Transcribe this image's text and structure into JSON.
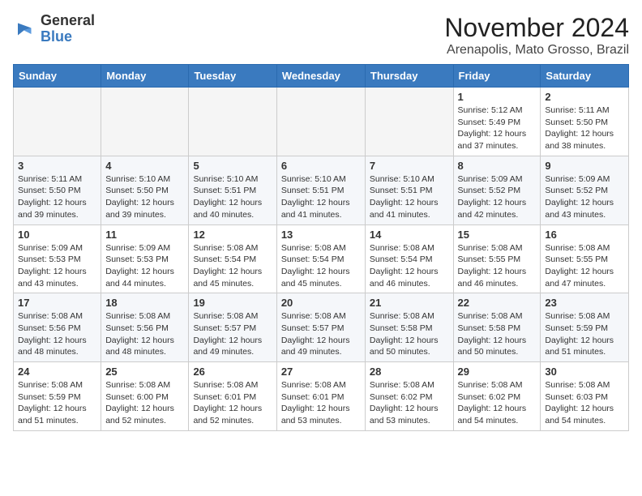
{
  "header": {
    "logo_line1": "General",
    "logo_line2": "Blue",
    "month": "November 2024",
    "location": "Arenapolis, Mato Grosso, Brazil"
  },
  "days_of_week": [
    "Sunday",
    "Monday",
    "Tuesday",
    "Wednesday",
    "Thursday",
    "Friday",
    "Saturday"
  ],
  "weeks": [
    [
      {
        "day": "",
        "empty": true
      },
      {
        "day": "",
        "empty": true
      },
      {
        "day": "",
        "empty": true
      },
      {
        "day": "",
        "empty": true
      },
      {
        "day": "",
        "empty": true
      },
      {
        "day": "1",
        "sunrise": "5:12 AM",
        "sunset": "5:49 PM",
        "daylight": "12 hours and 37 minutes."
      },
      {
        "day": "2",
        "sunrise": "5:11 AM",
        "sunset": "5:50 PM",
        "daylight": "12 hours and 38 minutes."
      }
    ],
    [
      {
        "day": "3",
        "sunrise": "5:11 AM",
        "sunset": "5:50 PM",
        "daylight": "12 hours and 39 minutes."
      },
      {
        "day": "4",
        "sunrise": "5:10 AM",
        "sunset": "5:50 PM",
        "daylight": "12 hours and 39 minutes."
      },
      {
        "day": "5",
        "sunrise": "5:10 AM",
        "sunset": "5:51 PM",
        "daylight": "12 hours and 40 minutes."
      },
      {
        "day": "6",
        "sunrise": "5:10 AM",
        "sunset": "5:51 PM",
        "daylight": "12 hours and 41 minutes."
      },
      {
        "day": "7",
        "sunrise": "5:10 AM",
        "sunset": "5:51 PM",
        "daylight": "12 hours and 41 minutes."
      },
      {
        "day": "8",
        "sunrise": "5:09 AM",
        "sunset": "5:52 PM",
        "daylight": "12 hours and 42 minutes."
      },
      {
        "day": "9",
        "sunrise": "5:09 AM",
        "sunset": "5:52 PM",
        "daylight": "12 hours and 43 minutes."
      }
    ],
    [
      {
        "day": "10",
        "sunrise": "5:09 AM",
        "sunset": "5:53 PM",
        "daylight": "12 hours and 43 minutes."
      },
      {
        "day": "11",
        "sunrise": "5:09 AM",
        "sunset": "5:53 PM",
        "daylight": "12 hours and 44 minutes."
      },
      {
        "day": "12",
        "sunrise": "5:08 AM",
        "sunset": "5:54 PM",
        "daylight": "12 hours and 45 minutes."
      },
      {
        "day": "13",
        "sunrise": "5:08 AM",
        "sunset": "5:54 PM",
        "daylight": "12 hours and 45 minutes."
      },
      {
        "day": "14",
        "sunrise": "5:08 AM",
        "sunset": "5:54 PM",
        "daylight": "12 hours and 46 minutes."
      },
      {
        "day": "15",
        "sunrise": "5:08 AM",
        "sunset": "5:55 PM",
        "daylight": "12 hours and 46 minutes."
      },
      {
        "day": "16",
        "sunrise": "5:08 AM",
        "sunset": "5:55 PM",
        "daylight": "12 hours and 47 minutes."
      }
    ],
    [
      {
        "day": "17",
        "sunrise": "5:08 AM",
        "sunset": "5:56 PM",
        "daylight": "12 hours and 48 minutes."
      },
      {
        "day": "18",
        "sunrise": "5:08 AM",
        "sunset": "5:56 PM",
        "daylight": "12 hours and 48 minutes."
      },
      {
        "day": "19",
        "sunrise": "5:08 AM",
        "sunset": "5:57 PM",
        "daylight": "12 hours and 49 minutes."
      },
      {
        "day": "20",
        "sunrise": "5:08 AM",
        "sunset": "5:57 PM",
        "daylight": "12 hours and 49 minutes."
      },
      {
        "day": "21",
        "sunrise": "5:08 AM",
        "sunset": "5:58 PM",
        "daylight": "12 hours and 50 minutes."
      },
      {
        "day": "22",
        "sunrise": "5:08 AM",
        "sunset": "5:58 PM",
        "daylight": "12 hours and 50 minutes."
      },
      {
        "day": "23",
        "sunrise": "5:08 AM",
        "sunset": "5:59 PM",
        "daylight": "12 hours and 51 minutes."
      }
    ],
    [
      {
        "day": "24",
        "sunrise": "5:08 AM",
        "sunset": "5:59 PM",
        "daylight": "12 hours and 51 minutes."
      },
      {
        "day": "25",
        "sunrise": "5:08 AM",
        "sunset": "6:00 PM",
        "daylight": "12 hours and 52 minutes."
      },
      {
        "day": "26",
        "sunrise": "5:08 AM",
        "sunset": "6:01 PM",
        "daylight": "12 hours and 52 minutes."
      },
      {
        "day": "27",
        "sunrise": "5:08 AM",
        "sunset": "6:01 PM",
        "daylight": "12 hours and 53 minutes."
      },
      {
        "day": "28",
        "sunrise": "5:08 AM",
        "sunset": "6:02 PM",
        "daylight": "12 hours and 53 minutes."
      },
      {
        "day": "29",
        "sunrise": "5:08 AM",
        "sunset": "6:02 PM",
        "daylight": "12 hours and 54 minutes."
      },
      {
        "day": "30",
        "sunrise": "5:08 AM",
        "sunset": "6:03 PM",
        "daylight": "12 hours and 54 minutes."
      }
    ]
  ],
  "labels": {
    "sunrise": "Sunrise:",
    "sunset": "Sunset:",
    "daylight": "Daylight:"
  }
}
